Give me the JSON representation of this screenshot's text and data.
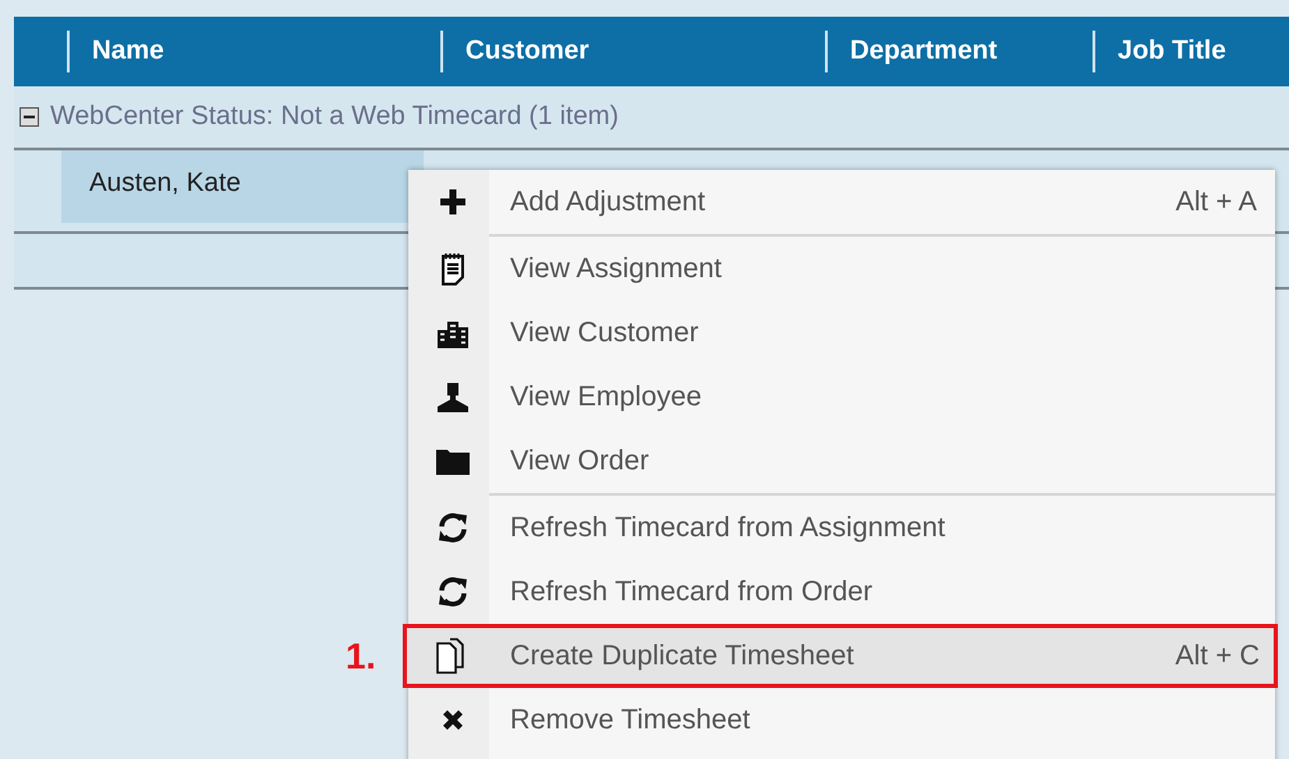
{
  "table": {
    "columns": [
      {
        "label": "Name"
      },
      {
        "label": "Customer"
      },
      {
        "label": "Department"
      },
      {
        "label": "Job Title"
      }
    ],
    "group": {
      "label": "WebCenter Status: Not a Web Timecard (1 item)",
      "expanded": true
    },
    "rows": [
      {
        "name": "Austen, Kate",
        "selected": true
      }
    ]
  },
  "context_menu": {
    "groups": [
      [
        {
          "kind": "plus",
          "label": "Add Adjustment",
          "shortcut": "Alt + A",
          "selected": false
        }
      ],
      [
        {
          "kind": "notepad",
          "label": "View Assignment",
          "selected": false
        },
        {
          "kind": "buildings",
          "label": "View Customer",
          "selected": false
        },
        {
          "kind": "person",
          "label": "View Employee",
          "selected": false
        },
        {
          "kind": "folder",
          "label": "View Order",
          "selected": false
        }
      ],
      [
        {
          "kind": "refresh",
          "label": "Refresh Timecard from Assignment",
          "selected": false
        },
        {
          "kind": "refresh",
          "label": "Refresh Timecard from Order",
          "selected": false
        },
        {
          "kind": "pages",
          "label": "Create Duplicate Timesheet",
          "shortcut": "Alt + C",
          "selected": true,
          "callout": "1."
        },
        {
          "kind": "cross",
          "label": "Remove Timesheet",
          "selected": false
        }
      ]
    ]
  }
}
